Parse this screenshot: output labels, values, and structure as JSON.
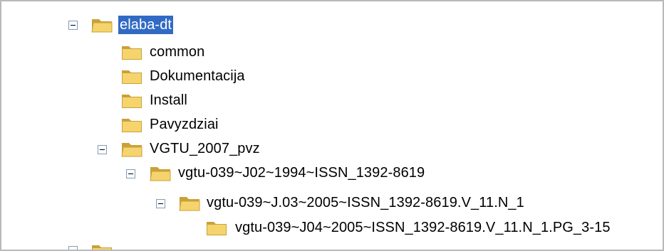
{
  "tree": {
    "root": {
      "label": "elaba-dt"
    },
    "children": [
      {
        "label": "common"
      },
      {
        "label": "Dokumentacija"
      },
      {
        "label": "Install"
      },
      {
        "label": "Pavyzdziai"
      },
      {
        "label": "VGTU_2007_pvz"
      }
    ],
    "level2": {
      "label": "vgtu-039~J02~1994~ISSN_1392-8619"
    },
    "level3": {
      "label": "vgtu-039~J.03~2005~ISSN_1392-8619.V_11.N_1"
    },
    "level4": {
      "label": "vgtu-039~J04~2005~ISSN_1392-8619.V_11.N_1.PG_3-15"
    }
  },
  "colors": {
    "selection": "#316ac5",
    "folder": "#f6d46d",
    "folder_dark": "#c9a13a"
  },
  "icons": {
    "folder": "folder-icon",
    "expander": "collapse-icon"
  }
}
